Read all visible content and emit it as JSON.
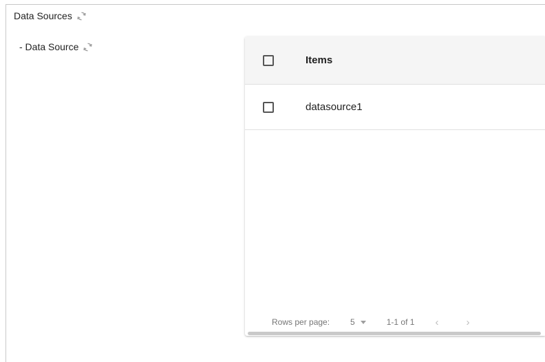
{
  "sections": {
    "title": "Data Sources",
    "sub_title": "- Data Source"
  },
  "table": {
    "header": "Items",
    "rows": [
      {
        "label": "datasource1"
      }
    ]
  },
  "pagination": {
    "rows_per_page_label": "Rows per page:",
    "rows_per_page_value": "5",
    "range": "1-1 of 1",
    "prev_glyph": "‹",
    "next_glyph": "›"
  },
  "icons": {
    "refresh": "refresh-icon",
    "checkbox": "checkbox-icon",
    "dropdown": "chevron-down-icon"
  },
  "colors": {
    "header_bg": "#f5f5f5",
    "border": "#e0e0e0",
    "muted_text": "#757575",
    "icon_gray": "#9e9e9e"
  }
}
